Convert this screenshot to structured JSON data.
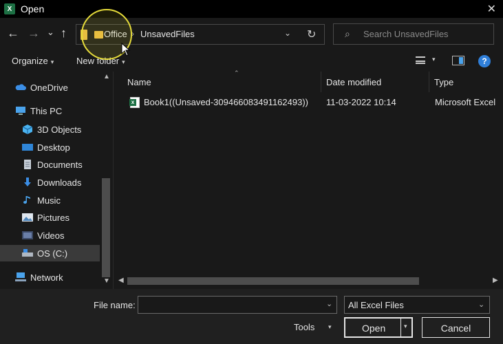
{
  "window": {
    "title": "Open",
    "app_icon": "excel-icon",
    "close_symbol": "✕"
  },
  "nav": {
    "back": "←",
    "forward": "→",
    "recent": "⌄",
    "up": "↑"
  },
  "address": {
    "crumbs": [
      "Office",
      "UnsavedFiles"
    ],
    "separator": "›",
    "dropdown": "⌄",
    "refresh": "↻"
  },
  "search": {
    "placeholder": "Search UnsavedFiles",
    "icon": "search-icon"
  },
  "toolbar": {
    "organize": "Organize",
    "new_folder": "New folder",
    "caret": "▾",
    "help": "?"
  },
  "sidebar": {
    "items": [
      {
        "label": "OneDrive",
        "icon": "cloud-icon",
        "color": "#3b8ee6"
      },
      {
        "label": "This PC",
        "icon": "computer-icon",
        "color": "#4aa3ec"
      },
      {
        "label": "3D Objects",
        "icon": "cube-icon",
        "color": "#4ab3f0"
      },
      {
        "label": "Desktop",
        "icon": "desktop-icon",
        "color": "#2f86d8"
      },
      {
        "label": "Documents",
        "icon": "document-icon",
        "color": "#9aa7b5"
      },
      {
        "label": "Downloads",
        "icon": "download-icon",
        "color": "#3b8ee6"
      },
      {
        "label": "Music",
        "icon": "music-icon",
        "color": "#4aa3ec"
      },
      {
        "label": "Pictures",
        "icon": "pictures-icon",
        "color": "#7fa9cf"
      },
      {
        "label": "Videos",
        "icon": "videos-icon",
        "color": "#6a7fa8"
      },
      {
        "label": "OS (C:)",
        "icon": "drive-icon",
        "color": "#b0b8c2",
        "selected": true
      },
      {
        "label": "Network",
        "icon": "network-icon",
        "color": "#4aa3ec"
      }
    ]
  },
  "columns": {
    "name": "Name",
    "date": "Date modified",
    "type": "Type"
  },
  "files": [
    {
      "name": "Book1((Unsaved-309466083491162493))",
      "date": "11-03-2022 10:14",
      "type": "Microsoft Excel"
    }
  ],
  "footer": {
    "file_name_label": "File name:",
    "file_name_value": "",
    "filter": "All Excel Files",
    "tools": "Tools",
    "open": "Open",
    "cancel": "Cancel",
    "dropdown": "⌄"
  },
  "colors": {
    "background": "#191919",
    "titlebar": "#000000",
    "highlight": "#e7dd3b",
    "accent": "#2f7fd9"
  }
}
